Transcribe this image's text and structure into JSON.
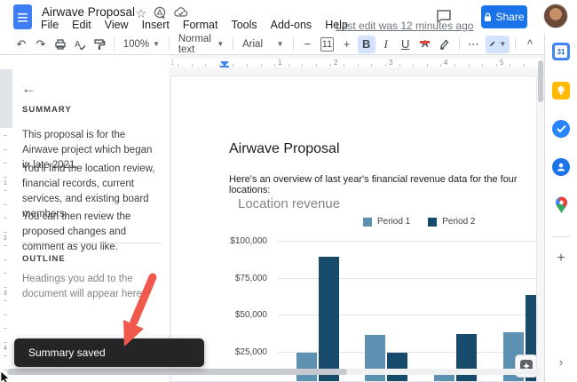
{
  "topbar": {
    "title": "Airwave Proposal",
    "menu_items": [
      "File",
      "Edit",
      "View",
      "Insert",
      "Format",
      "Tools",
      "Add-ons",
      "Help"
    ],
    "last_edit": "Last edit was 12 minutes ago",
    "share_label": "Share"
  },
  "toolbar": {
    "zoom_value": "100%",
    "style_value": "Normal text",
    "font_value": "Arial",
    "font_size_value": "11",
    "bold_label": "B",
    "italic_label": "I",
    "underline_label": "U",
    "text_color_label": "A",
    "more_label": "⋯"
  },
  "summary_panel": {
    "summary_heading": "SUMMARY",
    "paragraphs": [
      "This proposal is for the Airwave project which began in late 2021.",
      "You'll find the location review, financial records, current services, and existing board members.",
      "You can then review the proposed changes and comment as you like."
    ],
    "outline_heading": "OUTLINE",
    "outline_placeholder": "Headings you add to the document will appear here."
  },
  "document": {
    "heading": "Airwave Proposal",
    "intro": "Here's an overview of last year's financial revenue data for the four locations:"
  },
  "chart_data": {
    "type": "bar",
    "title": "Location revenue",
    "categories": [
      "",
      "",
      "",
      ""
    ],
    "series": [
      {
        "name": "Period 1",
        "color": "#5d91b1",
        "values": [
          24000,
          36000,
          10000,
          38000
        ]
      },
      {
        "name": "Period 2",
        "color": "#174a6b",
        "values": [
          89000,
          24000,
          37000,
          63000
        ]
      }
    ],
    "ylim": [
      0,
      100000
    ],
    "y_ticks": [
      "$100,000",
      "$75,000",
      "$50,000",
      "$25,000"
    ],
    "y_tick_values": [
      100000,
      75000,
      50000,
      25000
    ],
    "legend_position": "top",
    "grid": true,
    "note": "Category axis labels are cut off below the visible viewport"
  },
  "toast": {
    "text": "Summary saved"
  },
  "rulers": {
    "horizontal_numbers": [
      "1",
      "1",
      "2",
      "3",
      "4",
      "5"
    ],
    "vertical_numbers": [
      "1",
      "2",
      "3",
      "4"
    ]
  },
  "apps_panel": {
    "calendar_label": "31"
  },
  "colors": {
    "accent_blue": "#1a73e8",
    "toast_bg": "#232527",
    "arrow_red": "#f2594d",
    "bar_light": "#5d91b1",
    "bar_dark": "#174a6b"
  }
}
